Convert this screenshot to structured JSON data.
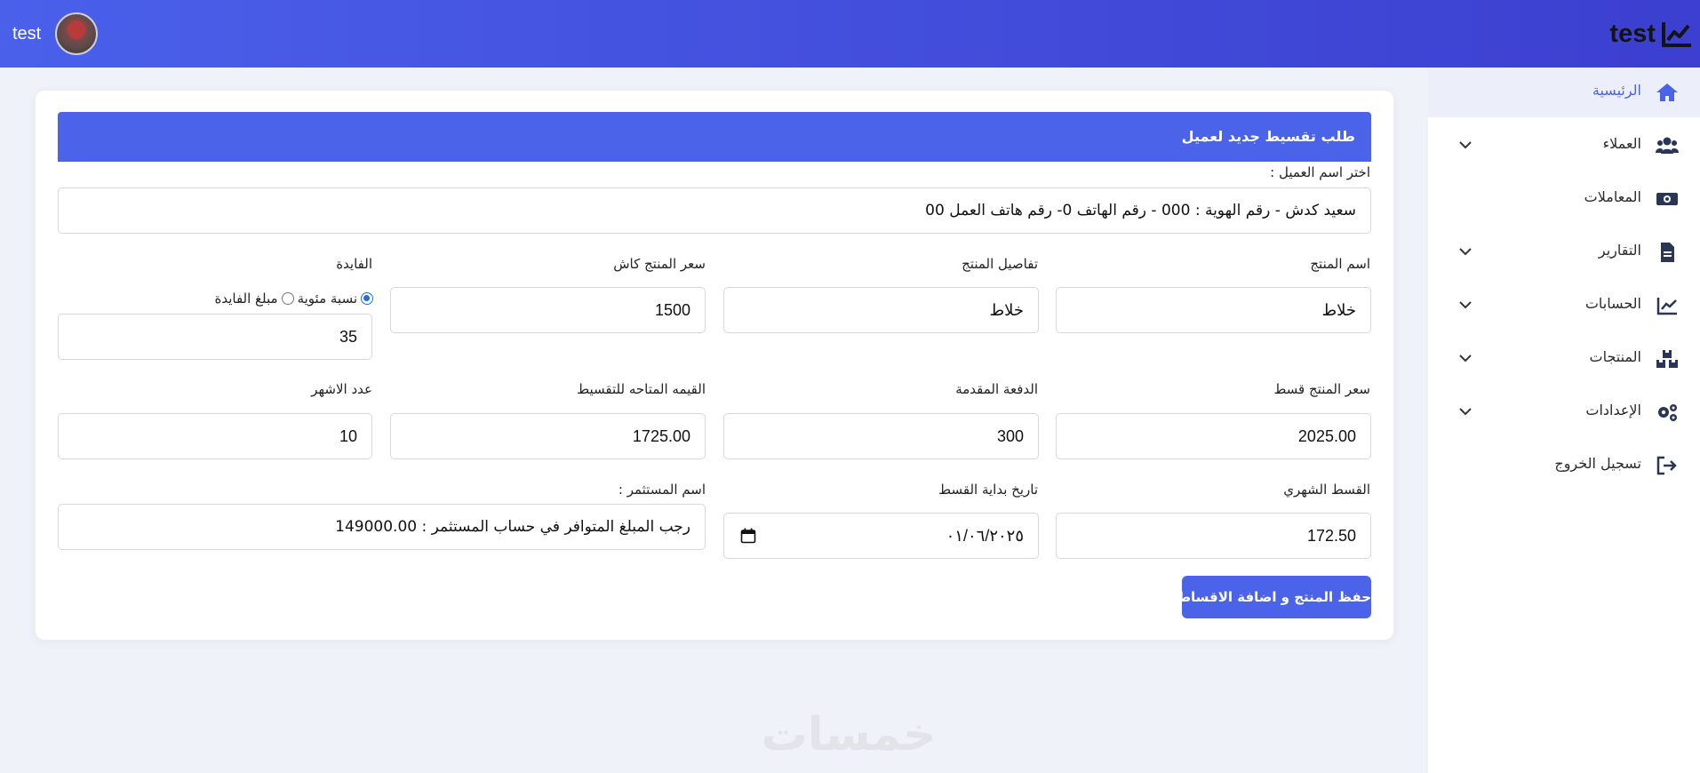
{
  "header": {
    "brand": "test",
    "brand_icon": "line-chart-icon",
    "user_name": "test"
  },
  "sidebar": {
    "items": [
      {
        "label": "الرئيسية",
        "icon": "home-icon",
        "active": true
      },
      {
        "label": "العملاء",
        "icon": "users-icon",
        "has_submenu": true
      },
      {
        "label": "المعاملات",
        "icon": "money-icon"
      },
      {
        "label": "التقارير",
        "icon": "file-icon",
        "has_submenu": true
      },
      {
        "label": "الحسابات",
        "icon": "chart-icon",
        "has_submenu": true
      },
      {
        "label": "المنتجات",
        "icon": "boxes-icon",
        "has_submenu": true
      },
      {
        "label": "الإعدادات",
        "icon": "gears-icon",
        "has_submenu": true
      },
      {
        "label": "تسجيل الخروج",
        "icon": "logout-icon"
      }
    ]
  },
  "form": {
    "title": "طلب تقسيط جديد لعميل",
    "client_label": "اختر اسم العميل :",
    "client_value": "سعيد كدش - رقم الهوية : 000 - رقم الهاتف 0- رقم هاتف العمل 00",
    "product_name_label": "اسم المنتج",
    "product_name_value": "خلاط",
    "product_details_label": "تفاصيل المنتج",
    "product_details_value": "خلاط",
    "cash_price_label": "سعر المنتج كاش",
    "cash_price_value": "1500",
    "profit_label": "الفايدة",
    "profit_radio_percent": "نسبة مئوية",
    "profit_radio_amount": "مبلغ الفايدة",
    "profit_value": "35",
    "installment_price_label": "سعر المنتج قسط",
    "installment_price_value": "2025.00",
    "down_payment_label": "الدفعة المقدمة",
    "down_payment_value": "300",
    "available_value_label": "القيمه المتاحه للتقسيط",
    "available_value_value": "1725.00",
    "months_label": "عدد الاشهر",
    "months_value": "10",
    "monthly_label": "القسط الشهري",
    "monthly_value": "172.50",
    "start_date_label": "تاريخ بداية القسط",
    "start_date_value": "٠١/٠٦/٢٠٢٥",
    "investor_label": "اسم المستثمر :",
    "investor_value": "رجب المبلغ المتوافر في حساب المستثمر : 149000.00",
    "save_button": "حفظ المنتج و اضافة الاقساط"
  },
  "watermark": "خمسات",
  "colors": {
    "accent": "#4a63e8",
    "header_start": "#4a60ea",
    "header_end": "#3c3fcf",
    "background": "#f0f2fa"
  }
}
